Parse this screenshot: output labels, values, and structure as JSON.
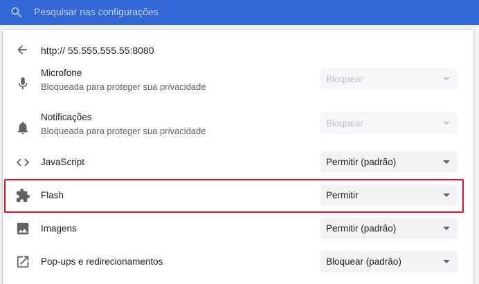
{
  "search": {
    "placeholder": "Pesquisar nas configurações"
  },
  "site": {
    "url": "http:// 55.555.555.55:8080"
  },
  "permissions": [
    {
      "name": "microphone-icon",
      "title": "Microfone",
      "subtitle": "Bloqueada para proteger sua privacidade",
      "value": "Bloquear",
      "disabled": true
    },
    {
      "name": "bell-icon",
      "title": "Notificações",
      "subtitle": "Bloqueada para proteger sua privacidade",
      "value": "Bloquear",
      "disabled": true
    },
    {
      "name": "code-icon",
      "title": "JavaScript",
      "value": "Permitir (padrão)"
    },
    {
      "name": "puzzle-icon",
      "title": "Flash",
      "value": "Permitir",
      "highlighted": true
    },
    {
      "name": "image-icon",
      "title": "Imagens",
      "value": "Permitir (padrão)"
    },
    {
      "name": "open-in-new-icon",
      "title": "Pop-ups e redirecionamentos",
      "value": "Bloquear (padrão)"
    }
  ],
  "colors": {
    "header": "#3367d6",
    "highlight": "#e4101e",
    "icon": "#5f6368"
  }
}
